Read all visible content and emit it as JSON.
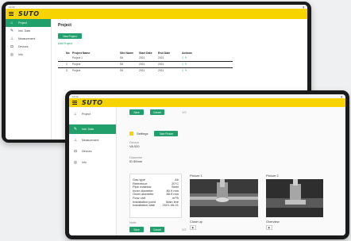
{
  "back": {
    "status_left": "12:34",
    "status_right": "▮",
    "logo": "SUTO",
    "sidebar": [
      {
        "label": "Project",
        "icon": "home-icon",
        "glyph": "⌂",
        "active": true
      },
      {
        "label": "Inst. Data",
        "icon": "wrench-icon",
        "glyph": "✎",
        "active": false
      },
      {
        "label": "Measurement",
        "icon": "gauge-icon",
        "glyph": "⊥",
        "active": false
      },
      {
        "label": "Devices",
        "icon": "device-icon",
        "glyph": "◘",
        "active": false
      },
      {
        "label": "Info",
        "icon": "info-icon",
        "glyph": "◎",
        "active": false
      }
    ],
    "page_title": "Project",
    "new_button": "New Project",
    "add_link": "Add Project",
    "columns": [
      "No",
      "Project Name",
      "Site Name",
      "Start Date",
      "End Date",
      "Actions"
    ],
    "rows": [
      {
        "no": "",
        "name": "Project 1",
        "site": "Sit",
        "start": "2021",
        "end": "2021"
      },
      {
        "no": "2",
        "name": "Project",
        "site": "Sit",
        "start": "2021",
        "end": "2021"
      },
      {
        "no": "3",
        "name": "Project",
        "site": "Sit",
        "start": "2021",
        "end": "2021"
      }
    ]
  },
  "front": {
    "status_left": "12:34",
    "status_right": "▮",
    "logo": "SUTO",
    "sidebar": [
      {
        "label": "Project",
        "icon": "home-icon",
        "glyph": "⌂",
        "active": false
      },
      {
        "label": "Inst. Data",
        "icon": "wrench-icon",
        "glyph": "✎",
        "active": true
      },
      {
        "label": "Measurement",
        "icon": "gauge-icon",
        "glyph": "⊥",
        "active": false
      },
      {
        "label": "Devices",
        "icon": "device-icon",
        "glyph": "◘",
        "active": false
      },
      {
        "label": "Info",
        "icon": "info-icon",
        "glyph": "◎",
        "active": false
      }
    ],
    "top_btn_1": "Save",
    "top_btn_2": "Cancel",
    "top_page": "1/2",
    "tab_label": "Settings",
    "tab_button": "Take Picture",
    "field_label": "Device",
    "field_value": "VA 520",
    "field2_label": "Diameter",
    "field2_value": "ID 80mm",
    "image_label_1": "Picture 1",
    "image_label_2": "Picture 2",
    "caption_1": "Close up",
    "caption_2": "Overview",
    "details": [
      {
        "k": "Gas type",
        "v": "Air"
      },
      {
        "k": "Reference",
        "v": "20°C"
      },
      {
        "k": "Pipe material",
        "v": "Steel"
      },
      {
        "k": "Inner diameter",
        "v": "80.9 mm"
      },
      {
        "k": "Outer diameter",
        "v": "88.9 mm"
      },
      {
        "k": "Flow unit",
        "v": "m³/h"
      },
      {
        "k": "Installation point",
        "v": "Main line"
      },
      {
        "k": "Installation date",
        "v": "2021-06-01"
      }
    ],
    "note_label": "Note",
    "bottom_btn_1": "Save",
    "bottom_btn_2": "Cancel",
    "bottom_page": "2/2"
  }
}
